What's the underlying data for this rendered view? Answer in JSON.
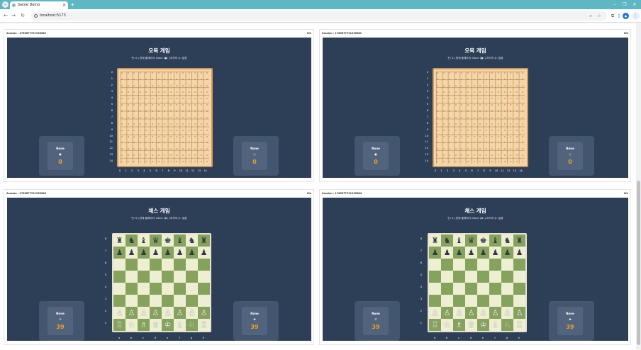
{
  "browser": {
    "tab_title": "Game Demo",
    "url": "localhost:5173"
  },
  "sessions": [
    {
      "session_label": "Session : 1765877791935681",
      "life_label": "life",
      "game": "omok",
      "title": "오목 게임",
      "info": "턴: 0 | 현재 플레이어: None (●) | 마지막 수: 없음",
      "row_labels": [
        "0",
        "1",
        "2",
        "3",
        "4",
        "5",
        "6",
        "7",
        "8",
        "9",
        "10",
        "11",
        "12",
        "13",
        "14"
      ],
      "col_labels": [
        "0",
        "1",
        "2",
        "3",
        "4",
        "5",
        "6",
        "7",
        "8",
        "9",
        "10",
        "11",
        "12",
        "13",
        "14"
      ],
      "left_player": {
        "name": "None",
        "icon": "●",
        "score": "0"
      },
      "right_player": {
        "name": "None",
        "icon": "○",
        "score": "0"
      }
    },
    {
      "session_label": "Session : 1765877791935681",
      "life_label": "life",
      "game": "omok",
      "title": "오목 게임",
      "info": "턴: 0 | 현재 플레이어: None (●) | 마지막 수: 없음",
      "row_labels": [
        "0",
        "1",
        "2",
        "3",
        "4",
        "5",
        "6",
        "7",
        "8",
        "9",
        "10",
        "11",
        "12",
        "13",
        "14"
      ],
      "col_labels": [
        "0",
        "1",
        "2",
        "3",
        "4",
        "5",
        "6",
        "7",
        "8",
        "9",
        "10",
        "11",
        "12",
        "13",
        "14"
      ],
      "left_player": {
        "name": "None",
        "icon": "●",
        "score": "0"
      },
      "right_player": {
        "name": "None",
        "icon": "○",
        "score": "0"
      }
    },
    {
      "session_label": "Session : 1765877791935684",
      "life_label": "life",
      "game": "chess",
      "title": "체스 게임",
      "info": "턴: 0 | 현재 플레이어: None (♚) | 마지막 수: 없음",
      "rank_labels": [
        "8",
        "7",
        "6",
        "5",
        "4",
        "3",
        "2",
        "1"
      ],
      "file_labels": [
        "a",
        "b",
        "c",
        "d",
        "e",
        "f",
        "g",
        "h"
      ],
      "left_player": {
        "name": "None",
        "icon": "♔",
        "score": "39"
      },
      "right_player": {
        "name": "None",
        "icon": "♚",
        "score": "39"
      }
    },
    {
      "session_label": "Session : 1765877791935684",
      "life_label": "life",
      "game": "chess",
      "title": "체스 게임",
      "info": "턴: 0 | 현재 플레이어: None (♚) | 마지막 수: 없음",
      "rank_labels": [
        "8",
        "7",
        "6",
        "5",
        "4",
        "3",
        "2",
        "1"
      ],
      "file_labels": [
        "a",
        "b",
        "c",
        "d",
        "e",
        "f",
        "g",
        "h"
      ],
      "left_player": {
        "name": "None",
        "icon": "♔",
        "score": "39"
      },
      "right_player": {
        "name": "None",
        "icon": "♚",
        "score": "39"
      }
    }
  ],
  "chess_position": {
    "rank8": [
      "♜",
      "♞",
      "♝",
      "♛",
      "♚",
      "♝",
      "♞",
      "♜"
    ],
    "rank7": [
      "♟",
      "♟",
      "♟",
      "♟",
      "♟",
      "♟",
      "♟",
      "♟"
    ],
    "rank2": [
      "♙",
      "♙",
      "♙",
      "♙",
      "♙",
      "♙",
      "♙",
      "♙"
    ],
    "rank1": [
      "♖",
      "♘",
      "♗",
      "♕",
      "♔",
      "♗",
      "♘",
      "♖"
    ]
  },
  "colors": {
    "panel_bg": "#2d3f57",
    "omok_board": "#f6d6a8",
    "chess_light": "#eeeed2",
    "chess_dark": "#86a35d",
    "score": "#f1a21e",
    "tabstrip": "#5fb7c4"
  }
}
